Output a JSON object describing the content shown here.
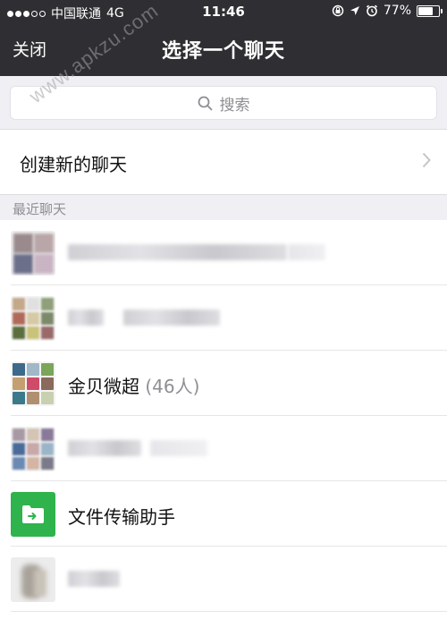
{
  "status": {
    "carrier": "中国联通",
    "network": "4G",
    "time": "11:46",
    "battery": "77%",
    "battery_level": 0.77
  },
  "nav": {
    "close_label": "关闭",
    "title": "选择一个聊天"
  },
  "search": {
    "placeholder": "搜索"
  },
  "new_chat": {
    "label": "创建新的聊天"
  },
  "section": {
    "recent_label": "最近聊天"
  },
  "chats": [
    {
      "name": "",
      "count": "",
      "blurred": true
    },
    {
      "name": "",
      "count": "",
      "blurred": true
    },
    {
      "name": "金贝微超",
      "count": "(46人)",
      "blurred": false
    },
    {
      "name": "",
      "count": "",
      "blurred": true
    },
    {
      "name": "文件传输助手",
      "count": "",
      "blurred": false
    },
    {
      "name": "",
      "count": "",
      "blurred": true
    }
  ],
  "watermark": "www.apkzu.com",
  "colors": {
    "topbar": "#2f2f33",
    "background": "#efeff4",
    "file_transfer_green": "#2fb34c",
    "secondary_text": "#8e8e93"
  }
}
